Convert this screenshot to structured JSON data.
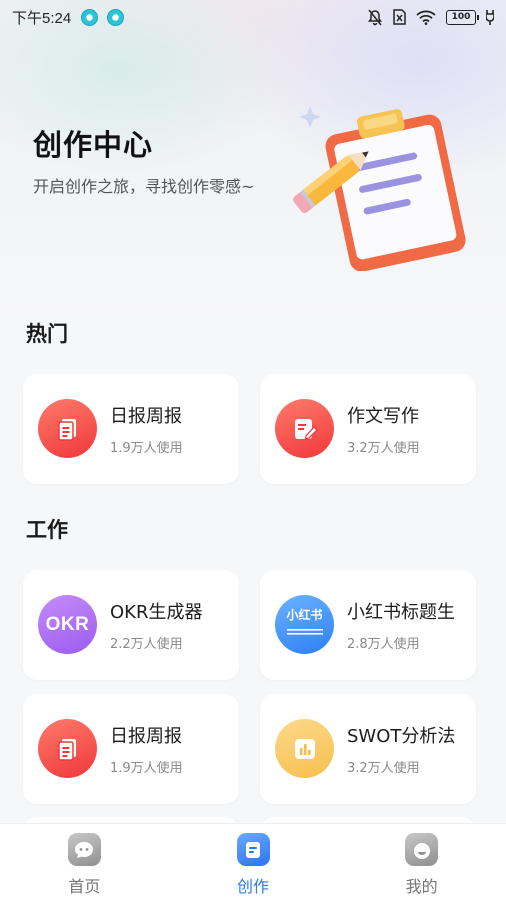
{
  "status_bar": {
    "time": "下午5:24",
    "battery": "100"
  },
  "hero": {
    "title": "创作中心",
    "subtitle": "开启创作之旅，寻找创作零感~"
  },
  "sections": {
    "hot": {
      "title": "热门",
      "items": [
        {
          "name": "日报周报",
          "usage": "1.9万人使用",
          "icon": "document-icon",
          "color": "#f0383a"
        },
        {
          "name": "作文写作",
          "usage": "3.2万人使用",
          "icon": "edit-document-icon",
          "color": "#f0383a"
        }
      ]
    },
    "work": {
      "title": "工作",
      "items": [
        {
          "name": "OKR生成器",
          "usage": "2.2万人使用",
          "icon": "okr-icon",
          "icon_text": "OKR",
          "color": "#9b5cf0"
        },
        {
          "name": "小红书标题生",
          "usage": "2.8万人使用",
          "icon": "xiaohongshu-icon",
          "icon_text": "小红书",
          "color": "#2f7ff6"
        },
        {
          "name": "日报周报",
          "usage": "1.9万人使用",
          "icon": "document-icon",
          "color": "#f0383a"
        },
        {
          "name": "SWOT分析法",
          "usage": "3.2万人使用",
          "icon": "bar-chart-icon",
          "color": "#f7bf4e"
        }
      ]
    }
  },
  "tab_bar": {
    "tabs": [
      {
        "label": "首页",
        "icon": "chat-bubble-icon",
        "active": false
      },
      {
        "label": "创作",
        "icon": "create-icon",
        "active": true
      },
      {
        "label": "我的",
        "icon": "profile-icon",
        "active": false
      }
    ],
    "active_color": "#2f78f0"
  }
}
